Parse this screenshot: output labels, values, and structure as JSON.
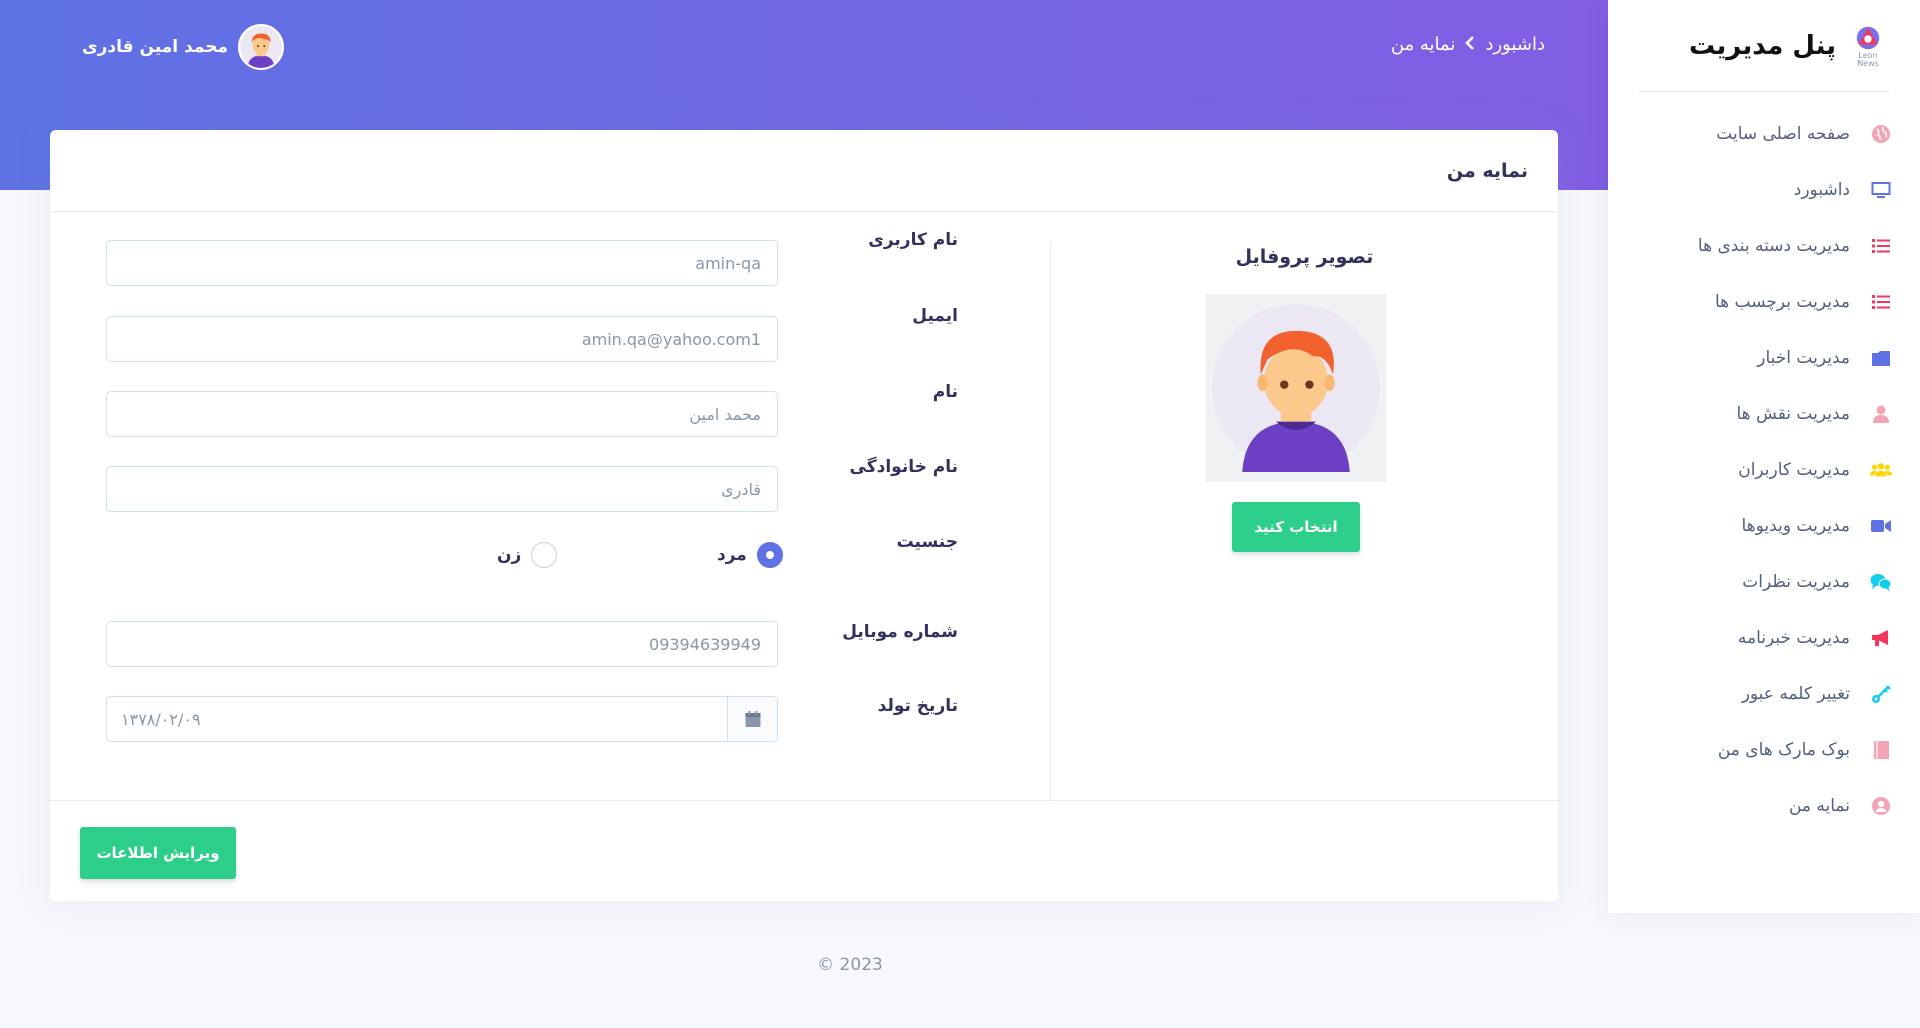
{
  "colors": {
    "primary": "#5e72e4",
    "success": "#2dce89",
    "header_gradient_end": "#825ee4"
  },
  "header": {
    "breadcrumb": [
      "داشبورد",
      "نمایه من"
    ],
    "user_name": "محمد امین قادری"
  },
  "sidebar": {
    "brand_title": "پنل مدیریت",
    "logo_text": "Leon News",
    "items": [
      {
        "label": "صفحه اصلی سایت",
        "icon": "globe-icon",
        "color": "#f3a4b5"
      },
      {
        "label": "داشبورد",
        "icon": "monitor-icon",
        "color": "#5e72e4"
      },
      {
        "label": "مدیریت دسته بندی ها",
        "icon": "list-icon",
        "color": "#f5365c"
      },
      {
        "label": "مدیریت برچسب ها",
        "icon": "list-icon",
        "color": "#f5365c"
      },
      {
        "label": "مدیریت اخبار",
        "icon": "folder-icon",
        "color": "#5e72e4"
      },
      {
        "label": "مدیریت نقش ها",
        "icon": "user-icon",
        "color": "#f3a4b5"
      },
      {
        "label": "مدیریت کاربران",
        "icon": "users-icon",
        "color": "#ffd600"
      },
      {
        "label": "مدیریت ویدیوها",
        "icon": "video-icon",
        "color": "#5e72e4"
      },
      {
        "label": "مدیریت نظرات",
        "icon": "comments-icon",
        "color": "#11cdef"
      },
      {
        "label": "مدیریت خبرنامه",
        "icon": "megaphone-icon",
        "color": "#f5365c"
      },
      {
        "label": "تغییر کلمه عبور",
        "icon": "key-icon",
        "color": "#11cdef"
      },
      {
        "label": "بوک مارک های من",
        "icon": "book-icon",
        "color": "#f3a4b5"
      },
      {
        "label": "نمایه من",
        "icon": "user-circle-icon",
        "color": "#f3a4b5"
      }
    ]
  },
  "card": {
    "title": "نمایه من",
    "profile_title": "تصویر پروفایل",
    "choose_button": "انتخاب کنید",
    "save_button": "ویرایش اطلاعات"
  },
  "form": {
    "username": {
      "label": "نام کاربری",
      "value": "amin-qa"
    },
    "email": {
      "label": "ایمیل",
      "value": "amin.qa@yahoo.com1"
    },
    "first_name": {
      "label": "نام",
      "value": "محمد امین"
    },
    "last_name": {
      "label": "نام خانوادگی",
      "value": "قادری"
    },
    "gender": {
      "label": "جنسیت",
      "male": "مرد",
      "female": "زن",
      "selected": "male"
    },
    "mobile": {
      "label": "شماره موبایل",
      "value": "09394639949"
    },
    "birth_date": {
      "label": "تاریخ تولد",
      "value": "۱۳۷۸/۰۲/۰۹"
    }
  },
  "footer": {
    "copyright": "© 2023"
  }
}
